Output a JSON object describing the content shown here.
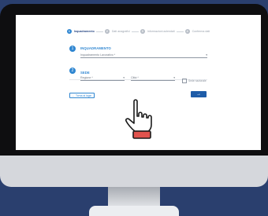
{
  "steps": [
    {
      "num": "1",
      "label": "Inquadramento"
    },
    {
      "num": "2",
      "label": "Dati anagrafici"
    },
    {
      "num": "3",
      "label": "Informazioni aziendali"
    },
    {
      "num": "4",
      "label": "Conferma dati"
    }
  ],
  "section1": {
    "icon": "1",
    "title": "INQUADRAMENTO",
    "field": "Inquadramento Lavorativo *"
  },
  "section2": {
    "icon": "2",
    "title": "SEDE",
    "regione": "Regione *",
    "citta": "Città *",
    "checkbox": "Sede nazionale"
  },
  "actions": {
    "back": "← Torna al login",
    "next": "→"
  },
  "colors": {
    "background": "#2a3f6e",
    "accent": "#2f86d1",
    "primary_button": "#1e5ca8",
    "hand_cuff": "#e0534d"
  }
}
